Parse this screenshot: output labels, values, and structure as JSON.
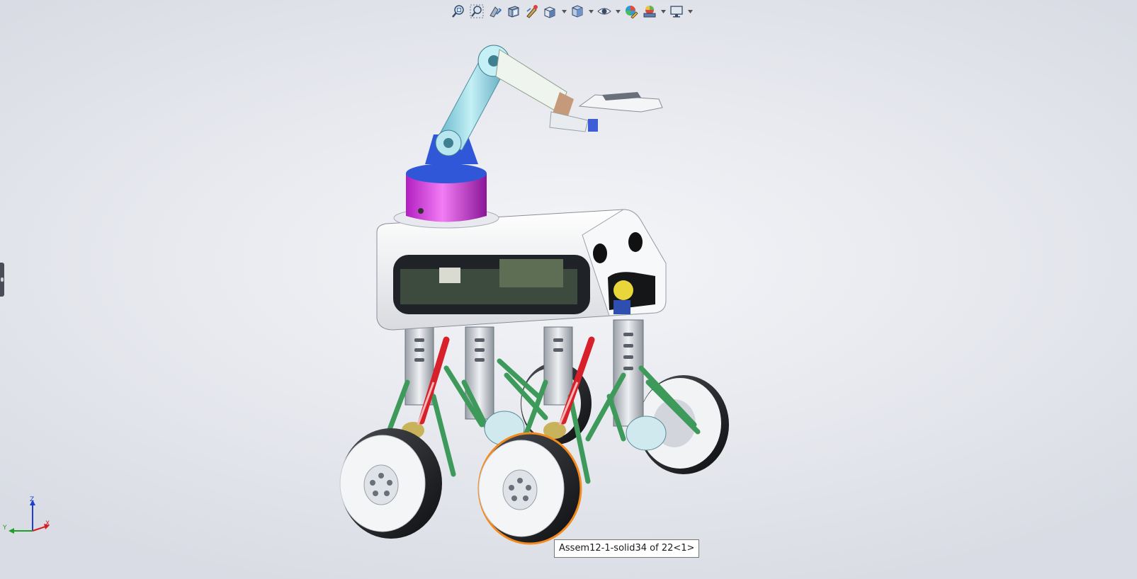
{
  "graphics_area": {
    "hud_toolbar": {
      "buttons": [
        {
          "icon": "zoom-to-fit-icon",
          "caret": false
        },
        {
          "icon": "zoom-to-area-icon",
          "caret": false
        },
        {
          "icon": "previous-view-icon",
          "caret": false
        },
        {
          "icon": "section-view-icon",
          "caret": false
        },
        {
          "icon": "dynamic-annotation-icon",
          "caret": false
        },
        {
          "icon": "view-orientation-icon",
          "caret": true
        },
        {
          "icon": "display-style-icon",
          "caret": true
        },
        {
          "icon": "hide-show-items-icon",
          "caret": true
        },
        {
          "icon": "edit-appearance-icon",
          "caret": false
        },
        {
          "icon": "apply-scene-icon",
          "caret": true
        },
        {
          "icon": "view-settings-icon",
          "caret": true
        }
      ]
    },
    "triad": {
      "x_label": "X",
      "y_label": "Y",
      "z_label": "Z"
    },
    "tooltip": {
      "text": "Assem12-1-solid34 of 22<1>"
    },
    "colors": {
      "arm": "#8fd6e2",
      "arm_base": "#e24fe6",
      "chassis": "#ffffff",
      "shock": "#d8202a",
      "links": "#3e9a5a",
      "selection_highlight": "#f28a1e"
    }
  }
}
